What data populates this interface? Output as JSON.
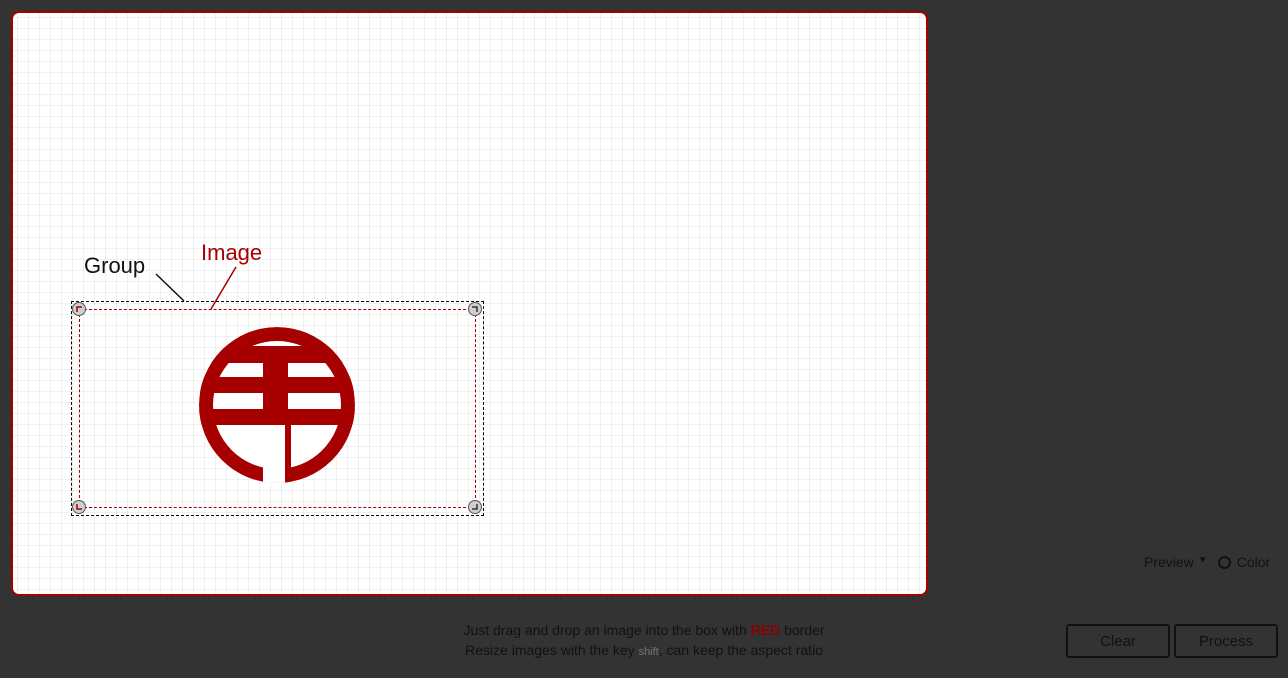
{
  "canvas": {
    "group_label": "Group",
    "image_label": "Image",
    "logo_icon": "circle-logo-icon",
    "accent_color": "#a60000"
  },
  "preview": {
    "label": "Preview",
    "caret": "▼",
    "color_label": "Color"
  },
  "instructions": {
    "line1_prefix": "Just drag and drop an image into the box with",
    "line1_strong": "RED",
    "line1_suffix": "border",
    "line2_prefix": "Resize images with the key",
    "line2_key": "shift",
    "line2_suffix": ", can keep the aspect ratio"
  },
  "buttons": {
    "clear": "Clear",
    "process": "Process"
  }
}
